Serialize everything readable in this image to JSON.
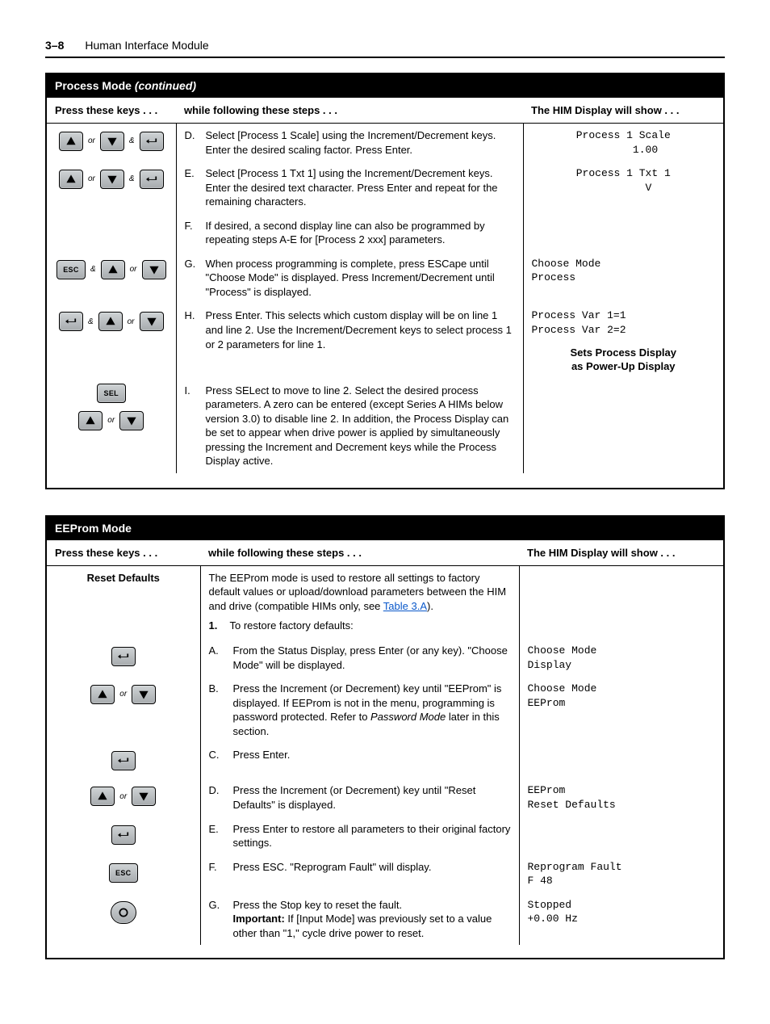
{
  "header": {
    "pageNumber": "3–8",
    "section": "Human Interface Module"
  },
  "table1": {
    "band": {
      "title": "Process Mode",
      "suffix": "(continued)"
    },
    "head": [
      "Press these keys . . .",
      "while following these steps . . .",
      "The HIM Display will show . . ."
    ],
    "rows": [
      {
        "letter": "D.",
        "text": "Select [Process 1 Scale] using the Increment/Decrement keys. Enter the desired scaling factor. Press Enter.",
        "display": "Process 1 Scale\n       1.00"
      },
      {
        "letter": "E.",
        "text": "Select [Process 1 Txt 1] using the Increment/Decrement keys. Enter the desired text character. Press Enter and repeat for the remaining characters.",
        "display": "Process 1 Txt 1\n        V"
      },
      {
        "letter": "F.",
        "text": "If desired, a second display line can also be programmed by repeating steps A-E for [Process 2 xxx] parameters.",
        "display": ""
      },
      {
        "letter": "G.",
        "text": "When process programming is complete, press ESCape until \"Choose Mode\" is displayed. Press Increment/Decrement until \"Process\" is displayed.",
        "display": "Choose Mode\nProcess"
      },
      {
        "letter": "H.",
        "text": "Press Enter. This selects which custom display will be on line 1 and line 2. Use the Increment/Decrement keys to select process 1 or 2 parameters for line 1.",
        "display": "Process Var 1=1\nProcess Var 2=2"
      },
      {
        "letter": "I.",
        "text": "Press SELect to move to line 2. Select the desired process parameters. A zero can be entered (except Series A HIMs below version 3.0) to disable line 2. In addition, the Process Display can be set to appear when drive power is applied by simultaneously pressing the Increment and Decrement keys while the Process Display active.",
        "display": ""
      }
    ],
    "setsNote": "Sets Process Display\nas Power-Up Display",
    "joinOr": "or",
    "joinAnd": "&"
  },
  "table2": {
    "band": {
      "title": "EEProm Mode"
    },
    "head": [
      "Press these keys . . .",
      "while following these steps . . .",
      "The HIM Display will show . . ."
    ],
    "resetLabel": "Reset Defaults",
    "introText": "The EEProm mode is used to restore all settings to factory default values or upload/download parameters between the HIM and drive (compatible HIMs only, see ",
    "introLinkText": "Table 3.A",
    "introAfter": ").",
    "listHead": "To restore factory defaults:",
    "rows": [
      {
        "letter": "A.",
        "text": "From the Status Display, press Enter (or any key). \"Choose Mode\" will be displayed.",
        "display": "Choose Mode\nDisplay",
        "keys": "enter"
      },
      {
        "letter": "B.",
        "text": "Press the Increment (or Decrement) key until \"EEProm\" is displayed. If EEProm is not in the menu, programming is password protected. Refer to ",
        "textItalic": "Password Mode",
        "textAfter": " later in this section.",
        "display": "Choose Mode\nEEProm",
        "keys": "incdec"
      },
      {
        "letter": "C.",
        "text": "Press Enter.",
        "display": "",
        "keys": "enter"
      },
      {
        "letter": "D.",
        "text": "Press the Increment (or Decrement) key until \"Reset Defaults\" is displayed.",
        "display": "EEProm\nReset Defaults",
        "keys": "incdec"
      },
      {
        "letter": "E.",
        "text": "Press Enter to restore all parameters to their original factory settings.",
        "display": "",
        "keys": "enter"
      },
      {
        "letter": "F.",
        "text": "Press ESC. \"Reprogram Fault\" will display.",
        "display": "Reprogram Fault\nF 48",
        "keys": "esc"
      },
      {
        "letter": "G.",
        "text": "Press the Stop key to reset the fault.",
        "importantLabel": "Important:",
        "importantText": " If [Input Mode] was previously set to a value other than \"1,\" cycle drive power to reset.",
        "display": "Stopped\n+0.00 Hz",
        "keys": "stop"
      }
    ],
    "joinOr": "or",
    "listNumber": "1."
  },
  "keyLabels": {
    "esc": "ESC",
    "sel": "SEL"
  }
}
